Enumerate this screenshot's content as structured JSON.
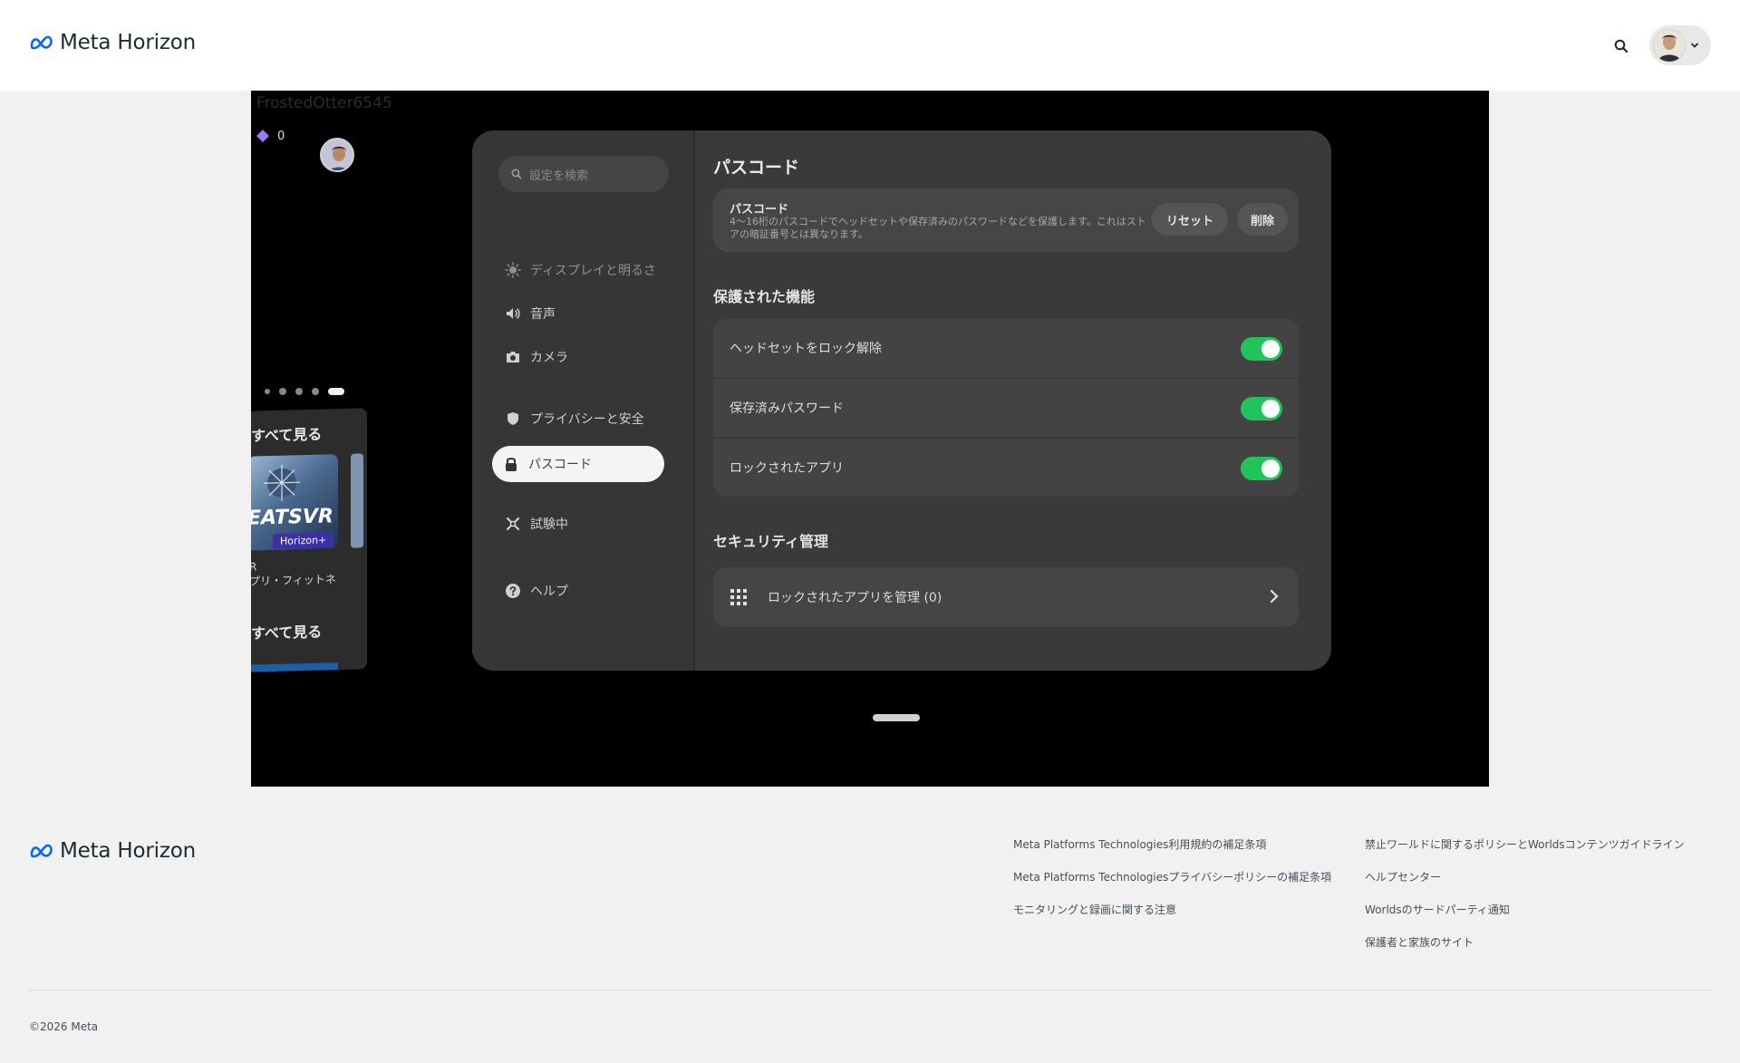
{
  "header": {
    "logo_text": "Meta Horizon",
    "icons": {
      "search": "search-icon",
      "chevron": "chevron-down-icon"
    }
  },
  "vr_screen": {
    "username": "FrostedOtter6545",
    "gem_count": "0",
    "library_card": {
      "see_all_label": "すべて見る",
      "thumbnail_title": "EATSVR",
      "thumbnail_badge": "Horizon+",
      "subtitle_line1": "R",
      "subtitle_line2": "プリ・フィットネ",
      "see_all_label_2": "すべて見る"
    },
    "settings": {
      "search_placeholder": "設定を検索",
      "sidebar": [
        {
          "label": "ディスプレイと明るさ",
          "icon": "sun-icon"
        },
        {
          "label": "音声",
          "icon": "speaker-icon"
        },
        {
          "label": "カメラ",
          "icon": "camera-icon"
        },
        {
          "label": "プライバシーと安全",
          "icon": "shield-icon"
        },
        {
          "label": "パスコード",
          "icon": "lock-icon",
          "active": true
        },
        {
          "label": "試験中",
          "icon": "experimental-icon"
        },
        {
          "label": "ヘルプ",
          "icon": "help-icon"
        }
      ],
      "title": "パスコード",
      "passcode_card": {
        "title": "パスコード",
        "description": "4〜16桁のパスコードでヘッドセットや保存済みのパスワードなどを保護します。これはストアの暗証番号とは異なります。",
        "reset_label": "リセット",
        "delete_label": "削除"
      },
      "protected_heading": "保護された機能",
      "toggles": [
        {
          "label": "ヘッドセットをロック解除",
          "on": true
        },
        {
          "label": "保存済みパスワード",
          "on": true
        },
        {
          "label": "ロックされたアプリ",
          "on": true
        }
      ],
      "security_heading": "セキュリティ管理",
      "manage_label": "ロックされたアプリを管理 (0)"
    }
  },
  "footer": {
    "logo_text": "Meta Horizon",
    "col1": [
      "Meta Platforms Technologies利用規約の補足条項",
      "Meta Platforms Technologiesプライバシーポリシーの補足条項",
      "モニタリングと録画に関する注意"
    ],
    "col2": [
      "禁止ワールドに関するポリシーとWorldsコンテンツガイドライン",
      "ヘルプセンター",
      "Worldsのサードパーティ通知",
      "保護者と家族のサイト"
    ],
    "copyright": "©2026 Meta"
  },
  "colors": {
    "brand": "#0866ff",
    "toggle_on": "#21c45a",
    "screen_bg": "#000000"
  }
}
